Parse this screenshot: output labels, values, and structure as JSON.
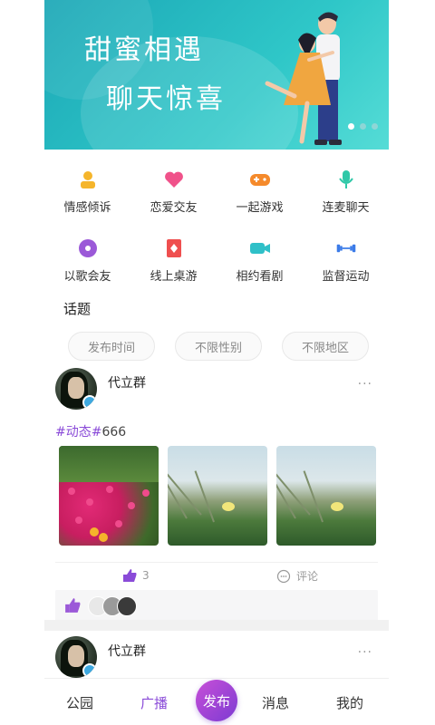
{
  "banner": {
    "line1": "甜蜜相遇",
    "line2": "聊天惊喜",
    "dot_count": 3,
    "active_dot": 0
  },
  "grid": [
    {
      "label": "情感倾诉",
      "icon": "person-icon",
      "color": "#f5b52b"
    },
    {
      "label": "恋爱交友",
      "icon": "heart-icon",
      "color": "#f0528a"
    },
    {
      "label": "一起游戏",
      "icon": "gamepad-icon",
      "color": "#f58a2b"
    },
    {
      "label": "连麦聊天",
      "icon": "microphone-icon",
      "color": "#2fc8a8"
    },
    {
      "label": "以歌会友",
      "icon": "music-disc-icon",
      "color": "#9b59d8"
    },
    {
      "label": "线上桌游",
      "icon": "playing-card-icon",
      "color": "#ef4f4f"
    },
    {
      "label": "相约看剧",
      "icon": "video-camera-icon",
      "color": "#2fc0c8"
    },
    {
      "label": "监督运动",
      "icon": "dumbbell-icon",
      "color": "#3b7be8"
    }
  ],
  "topics": {
    "title": "话题",
    "filters": [
      "发布时间",
      "不限性别",
      "不限地区"
    ]
  },
  "posts": [
    {
      "name": "代立群",
      "more": "···",
      "tag": "#动态#",
      "tag_num": "666",
      "likes": "3",
      "comment_label": "评论"
    },
    {
      "name": "代立群",
      "more": "···"
    }
  ],
  "nav": {
    "items": [
      "公园",
      "广播",
      "消息",
      "我的"
    ],
    "publish": "发布",
    "active_index": 1,
    "accent": "#8a4bd8"
  }
}
